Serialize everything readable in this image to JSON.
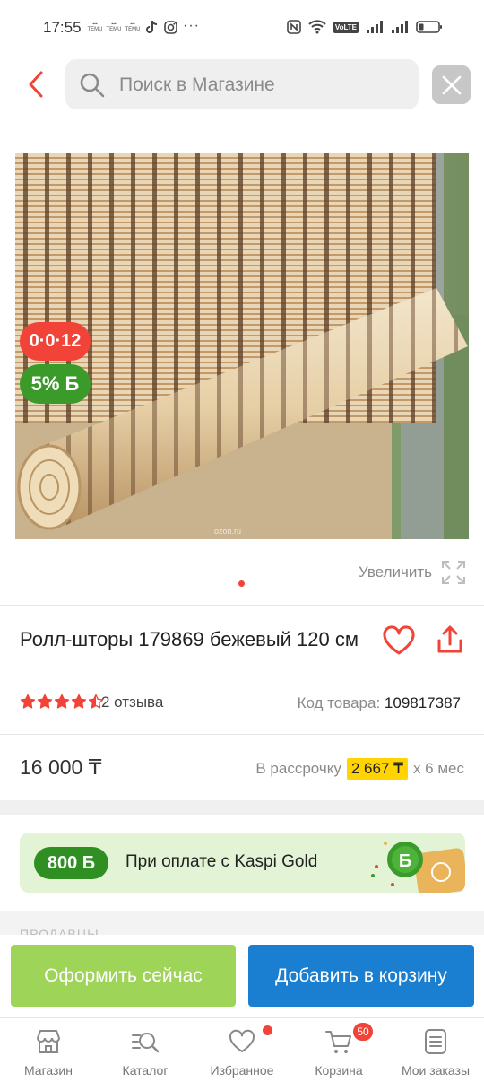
{
  "status_bar": {
    "time": "17:55",
    "mini_app_label": "TEMU",
    "more": "···",
    "network_label": "VoLTE"
  },
  "search": {
    "placeholder": "Поиск в Магазине"
  },
  "product": {
    "timer_badge": "0·0·12",
    "bonus_badge": "5% Б",
    "image_watermark": "ozon.ru",
    "zoom_label": "Увеличить",
    "title": "Ролл-шторы 179869 бежевый 120 см",
    "rating": 4.5,
    "rating_max": 5,
    "reviews": "2 отзыва",
    "code_label": "Код товара:",
    "code_value": "109817387",
    "price": "16 000 ₸",
    "installment_label": "В рассрочку",
    "installment_amount": "2 667 ₸",
    "installment_term": "x 6 мес"
  },
  "kaspi": {
    "bonus": "800 Б",
    "text": "При оплате с Kaspi Gold"
  },
  "sellers_label": "ПРОДАВЦЫ",
  "actions": {
    "order_now": "Оформить сейчас",
    "add_to_cart": "Добавить в корзину"
  },
  "nav": {
    "shop": "Магазин",
    "catalog": "Каталог",
    "favorites": "Избранное",
    "cart": "Корзина",
    "cart_count": "50",
    "orders": "Мои заказы"
  },
  "colors": {
    "accent_red": "#f14337",
    "kaspi_green": "#3a9b2a",
    "order_button": "#9ed458",
    "cart_button": "#1a7ed1",
    "installment_highlight": "#ffd400"
  }
}
